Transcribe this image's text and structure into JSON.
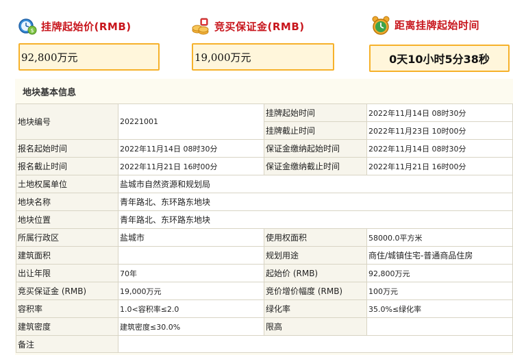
{
  "stats": [
    {
      "label": "挂牌起始价(RMB)",
      "value": "92,800万元",
      "icon": "money-clock-icon"
    },
    {
      "label": "竞买保证金(RMB)",
      "value": "19,000万元",
      "icon": "coins-icon"
    },
    {
      "label": "距离挂牌起始时间",
      "value": "0天10小时5分38秒",
      "icon": "alarm-clock-icon"
    }
  ],
  "section_title": "地块基本信息",
  "rows": {
    "plot_no": {
      "label": "地块编号",
      "value": "20221001"
    },
    "list_start": {
      "label": "挂牌起始时间",
      "value": "2022年11月14日 08时30分"
    },
    "list_end": {
      "label": "挂牌截止时间",
      "value": "2022年11月23日 10时00分"
    },
    "reg_start": {
      "label": "报名起始时间",
      "value": "2022年11月14日 08时30分"
    },
    "dep_start": {
      "label": "保证金缴纳起始时间",
      "value": "2022年11月14日 08时30分"
    },
    "reg_end": {
      "label": "报名截止时间",
      "value": "2022年11月21日 16时00分"
    },
    "dep_end": {
      "label": "保证金缴纳截止时间",
      "value": "2022年11月21日 16时00分"
    },
    "owner": {
      "label": "土地权属单位",
      "value": "盐城市自然资源和规划局"
    },
    "name": {
      "label": "地块名称",
      "value": "青年路北、东环路东地块"
    },
    "location": {
      "label": "地块位置",
      "value": "青年路北、东环路东地块"
    },
    "district": {
      "label": "所属行政区",
      "value": "盐城市"
    },
    "area": {
      "label": "使用权面积",
      "value": "58000.0平方米"
    },
    "build_area": {
      "label": "建筑面积",
      "value": ""
    },
    "usage": {
      "label": "规划用途",
      "value": "商住/城镇住宅-普通商品住房"
    },
    "term": {
      "label": "出让年限",
      "value": "70年"
    },
    "start_price": {
      "label": "起始价 (RMB)",
      "value": "92,800万元"
    },
    "deposit": {
      "label": "竞买保证金 (RMB)",
      "value": "19,000万元"
    },
    "increment": {
      "label": "竞价增价幅度 (RMB)",
      "value": "100万元"
    },
    "far": {
      "label": "容积率",
      "value": "1.0<容积率≤2.0"
    },
    "green": {
      "label": "绿化率",
      "value": "35.0%≤绿化率"
    },
    "density": {
      "label": "建筑密度",
      "value": "建筑密度≤30.0%"
    },
    "height": {
      "label": "限高",
      "value": ""
    },
    "remark": {
      "label": "备注",
      "value": ""
    }
  },
  "colors": {
    "accent": "#c8161d",
    "box_border": "#f6b12a",
    "box_bg": "#fff6db"
  }
}
